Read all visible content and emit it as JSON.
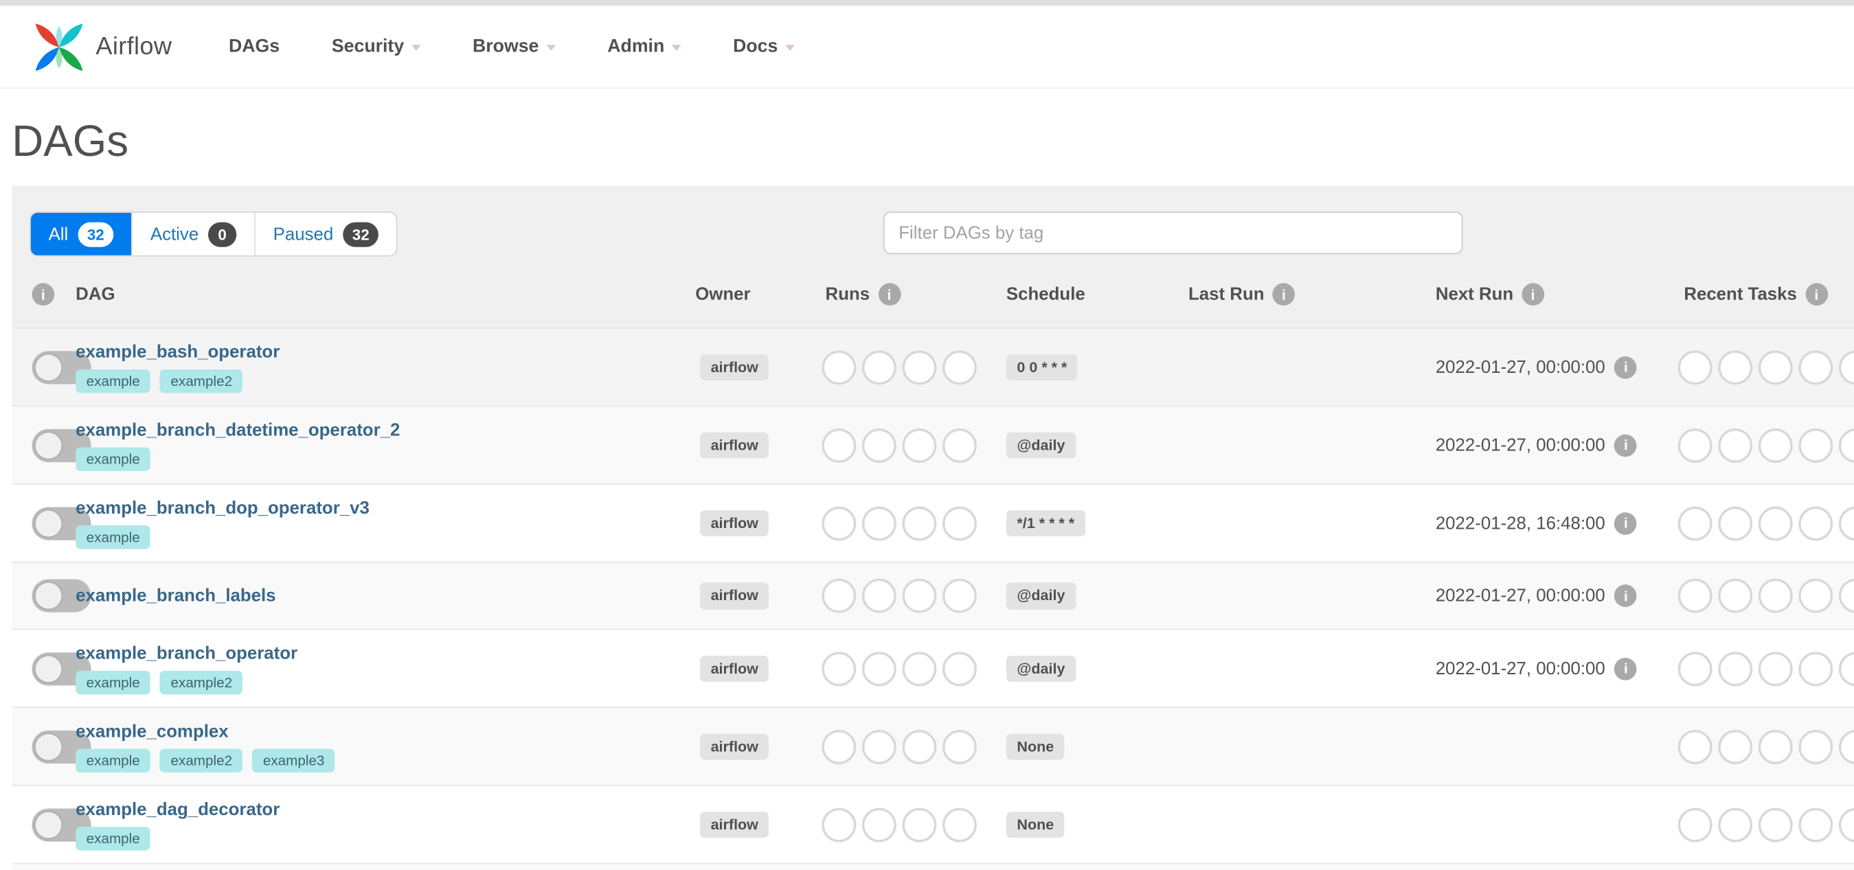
{
  "navbar": {
    "brand": "Airflow",
    "items": [
      {
        "label": "DAGs",
        "caret": false
      },
      {
        "label": "Security",
        "caret": true
      },
      {
        "label": "Browse",
        "caret": true
      },
      {
        "label": "Admin",
        "caret": true
      },
      {
        "label": "Docs",
        "caret": true
      }
    ]
  },
  "page": {
    "title": "DAGs"
  },
  "tabs": [
    {
      "label": "All",
      "count": "32",
      "active": true
    },
    {
      "label": "Active",
      "count": "0",
      "active": false
    },
    {
      "label": "Paused",
      "count": "32",
      "active": false
    }
  ],
  "filter": {
    "placeholder": "Filter DAGs by tag"
  },
  "table": {
    "headers": {
      "dag": "DAG",
      "owner": "Owner",
      "runs": "Runs",
      "schedule": "Schedule",
      "last_run": "Last Run",
      "next_run": "Next Run",
      "recent_tasks": "Recent Tasks"
    },
    "runs_circle_slots": 4,
    "recent_tasks_circle_slots": 5,
    "rows": [
      {
        "name": "example_bash_operator",
        "tags": [
          "example",
          "example2"
        ],
        "owner": "airflow",
        "schedule": "0 0 * * *",
        "last_run": null,
        "next_run": "2022-01-27, 00:00:00"
      },
      {
        "name": "example_branch_datetime_operator_2",
        "tags": [
          "example"
        ],
        "owner": "airflow",
        "schedule": "@daily",
        "last_run": null,
        "next_run": "2022-01-27, 00:00:00"
      },
      {
        "name": "example_branch_dop_operator_v3",
        "tags": [
          "example"
        ],
        "owner": "airflow",
        "schedule": "*/1 * * * *",
        "last_run": null,
        "next_run": "2022-01-28, 16:48:00"
      },
      {
        "name": "example_branch_labels",
        "tags": [],
        "owner": "airflow",
        "schedule": "@daily",
        "last_run": null,
        "next_run": "2022-01-27, 00:00:00"
      },
      {
        "name": "example_branch_operator",
        "tags": [
          "example",
          "example2"
        ],
        "owner": "airflow",
        "schedule": "@daily",
        "last_run": null,
        "next_run": "2022-01-27, 00:00:00"
      },
      {
        "name": "example_complex",
        "tags": [
          "example",
          "example2",
          "example3"
        ],
        "owner": "airflow",
        "schedule": "None",
        "last_run": null,
        "next_run": null
      },
      {
        "name": "example_dag_decorator",
        "tags": [
          "example"
        ],
        "owner": "airflow",
        "schedule": "None",
        "last_run": null,
        "next_run": null
      }
    ]
  },
  "colors": {
    "accent_blue": "#017cee",
    "tab_link_blue": "#2077b4",
    "tag_background": "#aee8e8",
    "dag_name_blue": "#38678a",
    "panel_gray": "#f0f0f0",
    "stripe_gray": "#f9f9f9",
    "badge_gray": "#e3e3e3",
    "logo_red": "#e4402f",
    "logo_teal": "#12c2cc",
    "logo_green": "#18a94b",
    "logo_blue": "#087cee"
  }
}
